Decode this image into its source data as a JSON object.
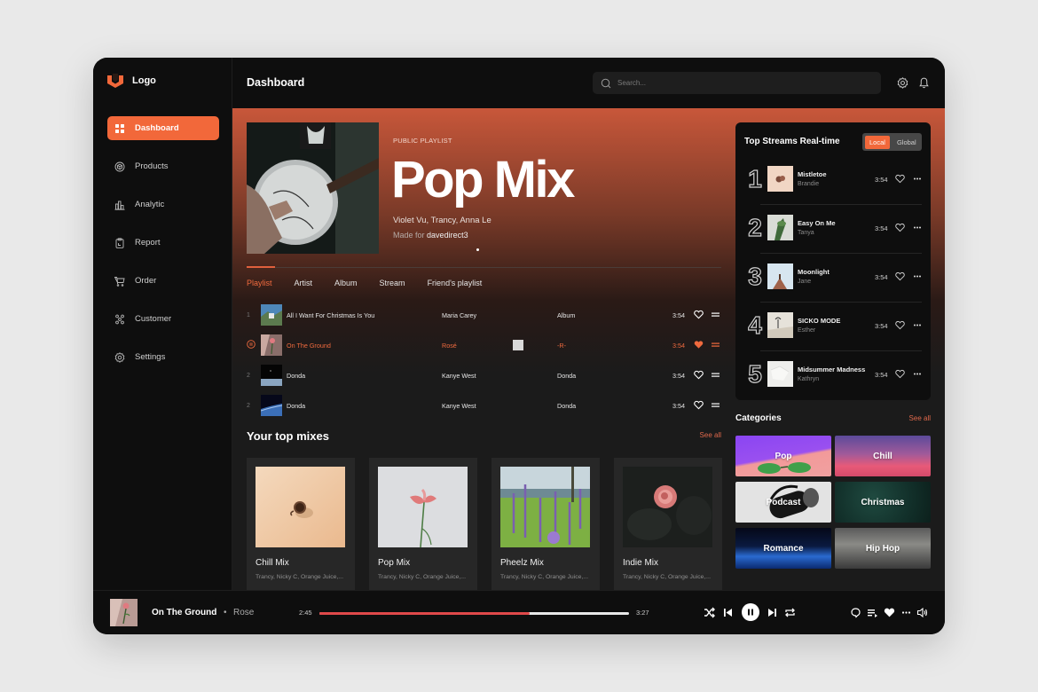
{
  "app": {
    "logo_text": "Logo",
    "accent_color": "#f2683a"
  },
  "sidebar": {
    "items": [
      {
        "label": "Dashboard",
        "icon": "grid-icon",
        "active": true
      },
      {
        "label": "Products",
        "icon": "box-icon",
        "active": false
      },
      {
        "label": "Analytic",
        "icon": "bar-chart-icon",
        "active": false
      },
      {
        "label": "Report",
        "icon": "clipboard-icon",
        "active": false
      },
      {
        "label": "Order",
        "icon": "cart-icon",
        "active": false
      },
      {
        "label": "Customer",
        "icon": "users-icon",
        "active": false
      },
      {
        "label": "Settings",
        "icon": "gear-icon",
        "active": false
      }
    ]
  },
  "header": {
    "title": "Dashboard",
    "search_placeholder": "Search..."
  },
  "hero": {
    "type_label": "PUBLIC PLAYLIST",
    "title": "Pop Mix",
    "artists": "Violet Vu, Trancy, Anna Le",
    "made_for_prefix": "Made for",
    "made_for_user": "davedirect3"
  },
  "tabs": [
    {
      "label": "Playlist",
      "active": true
    },
    {
      "label": "Artist",
      "active": false
    },
    {
      "label": "Album",
      "active": false
    },
    {
      "label": "Stream",
      "active": false
    },
    {
      "label": "Friend's playlist",
      "active": false
    }
  ],
  "tracks": [
    {
      "num": "1",
      "title": "All I Want For Christmas Is You",
      "artist": "Maria Carey",
      "album": "Album",
      "duration": "3:54",
      "liked": false,
      "playing": false
    },
    {
      "num": "",
      "title": "On The Ground",
      "artist": "Rosé",
      "album": "-R-",
      "duration": "3:54",
      "liked": true,
      "playing": true
    },
    {
      "num": "2",
      "title": "Donda",
      "artist": "Kanye West",
      "album": "Donda",
      "duration": "3:54",
      "liked": false,
      "playing": false
    },
    {
      "num": "2",
      "title": "Donda",
      "artist": "Kanye West",
      "album": "Donda",
      "duration": "3:54",
      "liked": false,
      "playing": false
    }
  ],
  "top_mixes": {
    "title": "Your top mixes",
    "see_all": "See all",
    "items": [
      {
        "name": "Chill Mix",
        "desc": "Trancy, Nicky C, Orange Juice,..."
      },
      {
        "name": "Pop Mix",
        "desc": "Trancy, Nicky C, Orange Juice,..."
      },
      {
        "name": "Pheelz Mix",
        "desc": "Trancy, Nicky C, Orange Juice,..."
      },
      {
        "name": "Indie Mix",
        "desc": "Trancy, Nicky C, Orange Juice,..."
      }
    ]
  },
  "top_streams": {
    "title": "Top Streams Real-time",
    "toggle": {
      "local": "Local",
      "global": "Global",
      "selected": "Local"
    },
    "items": [
      {
        "rank": "1",
        "song": "Mistletoe",
        "artist": "Brandie",
        "duration": "3:54"
      },
      {
        "rank": "2",
        "song": "Easy On Me",
        "artist": "Tanya",
        "duration": "3:54"
      },
      {
        "rank": "3",
        "song": "Moonlight",
        "artist": "Jane",
        "duration": "3:54"
      },
      {
        "rank": "4",
        "song": "SICKO MODE",
        "artist": "Esther",
        "duration": "3:54"
      },
      {
        "rank": "5",
        "song": "Midsummer Madness",
        "artist": "Kathryn",
        "duration": "3:54"
      }
    ]
  },
  "categories": {
    "title": "Categories",
    "see_all": "See all",
    "items": [
      "Pop",
      "Chill",
      "Podcast",
      "Christmas",
      "Romance",
      "Hip Hop"
    ]
  },
  "player": {
    "title": "On The Ground",
    "separator": "•",
    "artist": "Rose",
    "current_time": "2:45",
    "total_time": "3:27",
    "progress": 0.68
  }
}
